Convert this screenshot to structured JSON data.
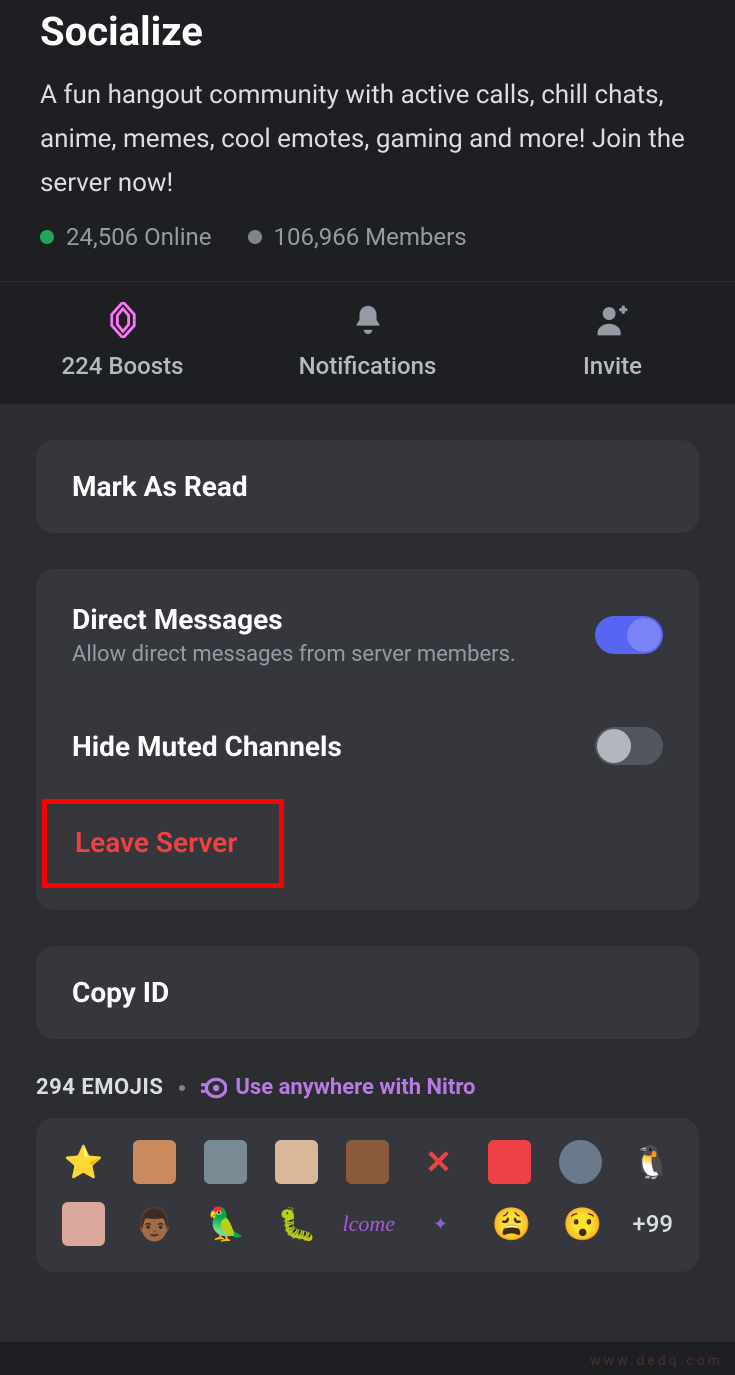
{
  "server": {
    "name": "Socialize",
    "description": "A fun hangout community with active calls, chill chats, anime, memes, cool emotes, gaming and more! Join the server now!",
    "online": "24,506 Online",
    "members": "106,966 Members"
  },
  "actions": {
    "boosts": "224 Boosts",
    "notifications": "Notifications",
    "invite": "Invite"
  },
  "options": {
    "mark_read": "Mark As Read",
    "dm_title": "Direct Messages",
    "dm_sub": "Allow direct messages from server members.",
    "hide_muted": "Hide Muted Channels",
    "leave": "Leave Server",
    "copy_id": "Copy ID"
  },
  "emojis": {
    "count": "294 EMOJIS",
    "nitro": "Use anywhere with Nitro",
    "more": "+99"
  },
  "watermark": "www.dedq.com"
}
